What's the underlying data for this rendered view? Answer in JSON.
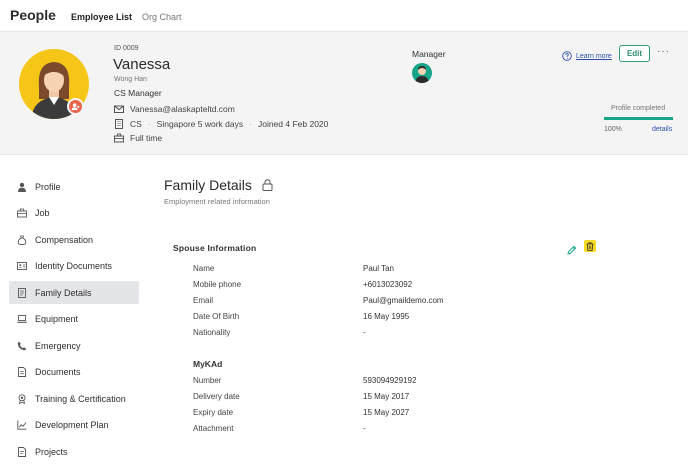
{
  "app": {
    "title": "People"
  },
  "top_tabs": [
    {
      "label": "Employee List",
      "active": true
    },
    {
      "label": "Org Chart",
      "active": false
    }
  ],
  "employee": {
    "id": "ID 0009",
    "name": "Vanessa",
    "alt_name": "Wong Han",
    "title": "CS Manager",
    "email": "Vanessa@alaskapteltd.com",
    "department": "CS",
    "location": "Singapore 5 work days",
    "joined": "Joined 4 Feb 2020",
    "employment_type": "Full time"
  },
  "manager": {
    "label": "Manager"
  },
  "actions": {
    "learn_more": "Learn more",
    "edit": "Edit",
    "more": "···"
  },
  "profile": {
    "label": "Profile completed",
    "percent_text": "100%",
    "percent": 100,
    "details": "details"
  },
  "sidebar": {
    "items": [
      {
        "label": "Profile",
        "icon": "user-icon"
      },
      {
        "label": "Job",
        "icon": "briefcase-icon"
      },
      {
        "label": "Compensation",
        "icon": "money-bag-icon"
      },
      {
        "label": "Identity Documents",
        "icon": "id-card-icon"
      },
      {
        "label": "Family Details",
        "icon": "family-doc-icon",
        "active": true
      },
      {
        "label": "Equipment",
        "icon": "laptop-icon"
      },
      {
        "label": "Emergency",
        "icon": "phone-icon"
      },
      {
        "label": "Documents",
        "icon": "document-icon"
      },
      {
        "label": "Training & Certification",
        "icon": "award-icon"
      },
      {
        "label": "Development Plan",
        "icon": "chart-icon"
      },
      {
        "label": "Projects",
        "icon": "folder-icon"
      }
    ]
  },
  "section": {
    "title": "Family Details",
    "subtitle": "Employment related information",
    "spouse_heading": "Spouse Information",
    "spouse_fields": [
      {
        "label": "Name",
        "value": "Paul Tan"
      },
      {
        "label": "Mobile phone",
        "value": "+6013023092"
      },
      {
        "label": "Email",
        "value": "Paul@gmaildemo.com"
      },
      {
        "label": "Date Of Birth",
        "value": "16 May 1995"
      },
      {
        "label": "Nationality",
        "value": "-"
      }
    ],
    "mykad_heading": "MyKAd",
    "mykad_fields": [
      {
        "label": "Number",
        "value": "593094929192"
      },
      {
        "label": "Delivery date",
        "value": "15 May 2017"
      },
      {
        "label": "Expiry date",
        "value": "15 May 2027"
      },
      {
        "label": "Attachment",
        "value": "-"
      }
    ]
  },
  "colors": {
    "accent": "#17a589",
    "link": "#2d4fa8",
    "avatar_bg": "#f5c518",
    "badge": "#e8654b",
    "delete": "#f7d91f"
  }
}
